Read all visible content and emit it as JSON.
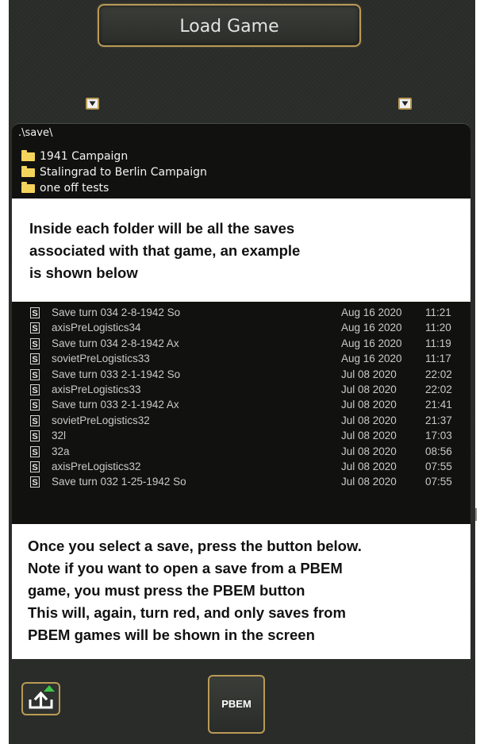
{
  "header": {
    "title": "Load Game"
  },
  "icons": {
    "dropdown_left": "chevron-down-icon",
    "dropdown_right": "chevron-down-icon",
    "folder": "folder-icon",
    "save": "save-file-icon",
    "load": "upload-icon"
  },
  "browser": {
    "path": ".\\save\\",
    "folders": [
      {
        "label": "1941 Campaign"
      },
      {
        "label": "Stalingrad to Berlin Campaign"
      },
      {
        "label": "one off tests"
      }
    ]
  },
  "note1": {
    "lines": [
      "Inside each folder will be all the saves",
      "associated with that game, an example",
      "is shown below"
    ]
  },
  "saves": [
    {
      "icon": "S",
      "name": "Save turn 034 2-8-1942 So",
      "date": "Aug 16 2020",
      "time": "11:21"
    },
    {
      "icon": "S",
      "name": "axisPreLogistics34",
      "date": "Aug 16 2020",
      "time": "11:20"
    },
    {
      "icon": "S",
      "name": "Save turn 034 2-8-1942 Ax",
      "date": "Aug 16 2020",
      "time": "11:19"
    },
    {
      "icon": "S",
      "name": "sovietPreLogistics33",
      "date": "Aug 16 2020",
      "time": "11:17"
    },
    {
      "icon": "S",
      "name": "Save turn 033 2-1-1942 So",
      "date": "Jul  08 2020",
      "time": "22:02"
    },
    {
      "icon": "S",
      "name": "axisPreLogistics33",
      "date": "Jul  08 2020",
      "time": "22:02"
    },
    {
      "icon": "S",
      "name": "Save turn 033 2-1-1942 Ax",
      "date": "Jul  08 2020",
      "time": "21:41"
    },
    {
      "icon": "S",
      "name": "sovietPreLogistics32",
      "date": "Jul  08 2020",
      "time": "21:37"
    },
    {
      "icon": "S",
      "name": "32l",
      "date": "Jul  08 2020",
      "time": "17:03"
    },
    {
      "icon": "S",
      "name": "32a",
      "date": "Jul  08 2020",
      "time": "08:56"
    },
    {
      "icon": "S",
      "name": "axisPreLogistics32",
      "date": "Jul  08 2020",
      "time": "07:55"
    },
    {
      "icon": "S",
      "name": "Save turn 032 1-25-1942 So",
      "date": "Jul  08 2020",
      "time": "07:55"
    }
  ],
  "note2": {
    "lines": [
      "Once you select a save, press the button below.",
      "Note if you want to open a save from a PBEM",
      "game, you must press the PBEM button",
      "This will, again, turn red, and only saves from",
      "PBEM games will be shown in the screen"
    ]
  },
  "footer": {
    "pbem_label": "PBEM"
  },
  "colors": {
    "frame_gold": "#b99a56",
    "panel": "#2a2c29",
    "list_bg": "#111210",
    "folder": "#f5d45c",
    "upload_arrow": "#3cc84a"
  }
}
